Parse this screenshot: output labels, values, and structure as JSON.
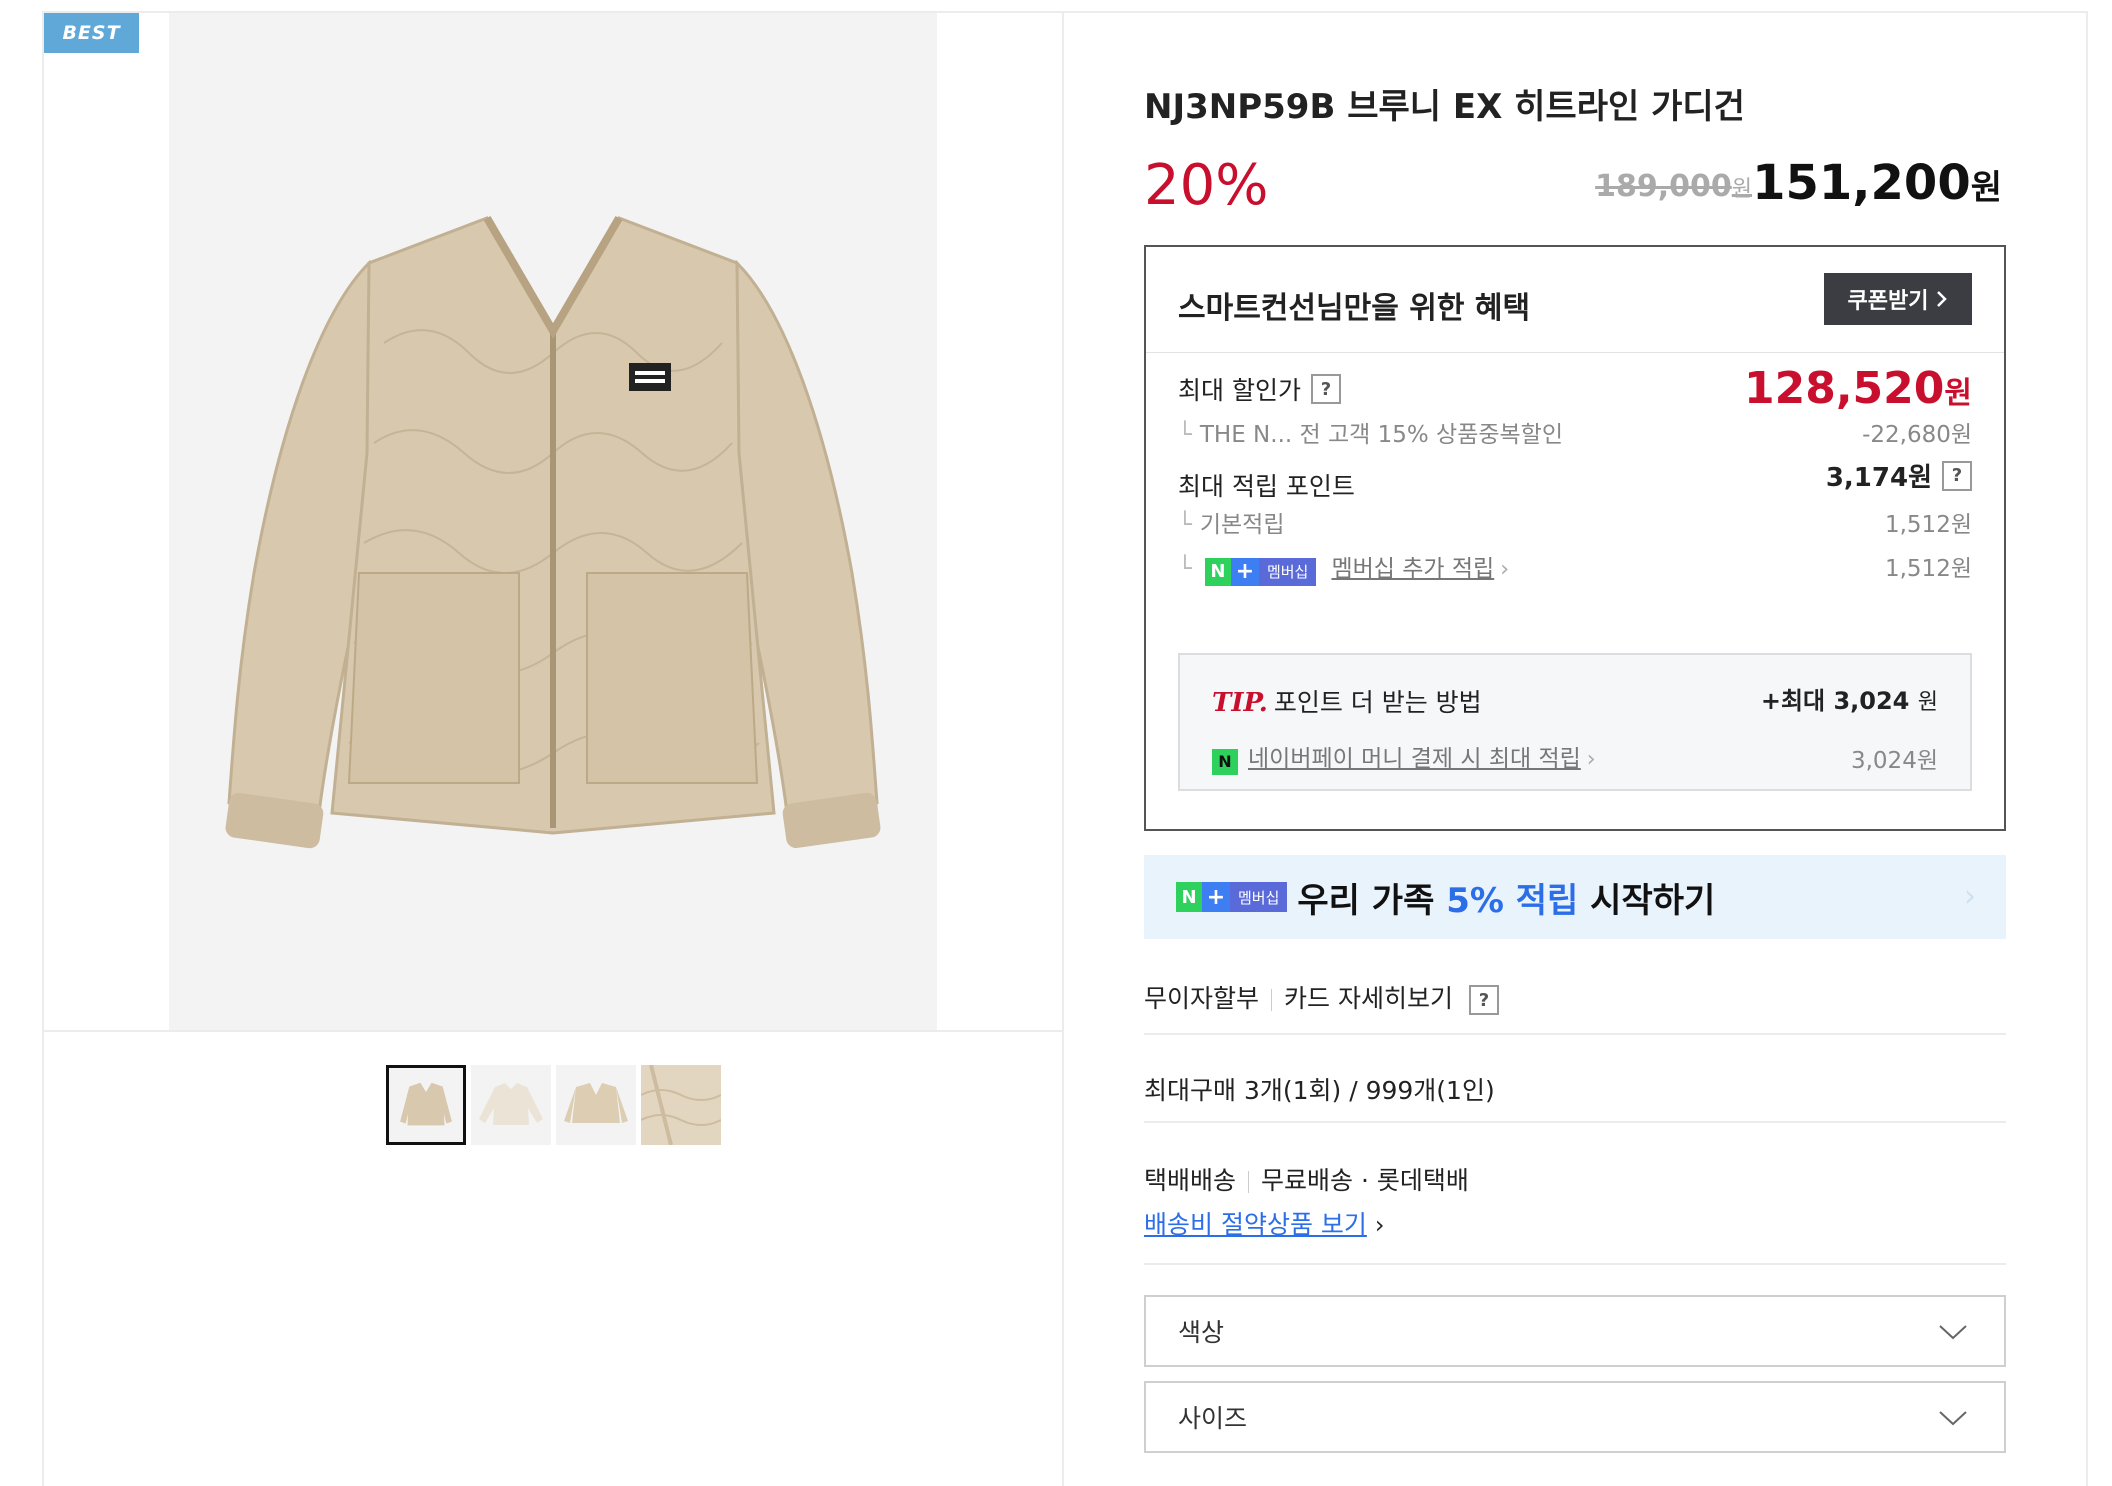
{
  "badge": "BEST",
  "gallery": {
    "main_image_alt": "",
    "thumbnails": [
      "",
      "",
      "",
      ""
    ]
  },
  "product": {
    "title": "NJ3NP59B 브루니 EX 히트라인 가디건",
    "discount_rate": "20%",
    "original_price": "189,000",
    "original_unit": "원",
    "sale_price": "151,200",
    "sale_unit": "원"
  },
  "benefit": {
    "title": "스마트컨선님만을 위한 혜택",
    "coupon_button": "쿠폰받기",
    "max_price_label": "최대 할인가",
    "max_price_value": "128,520",
    "max_price_unit": "원",
    "max_price_detail": "THE N... 전 고객 15% 상품중복할인",
    "max_price_discount": "-22,680원",
    "points_label": "최대 적립 포인트",
    "points_value": "3,174원",
    "basic_points_label": "기본적립",
    "basic_points_value": "1,512원",
    "membership_badge_n": "N",
    "membership_badge_plus": "+",
    "membership_badge_text": "멤버십",
    "membership_points_label": "멤버십 추가 적립",
    "membership_points_value": "1,512원",
    "tip": {
      "label": "TIP.",
      "title": "포인트 더 받는 방법",
      "max_value": "+최대 3,024",
      "max_unit": "원",
      "npay_icon": "N",
      "npay_link": "네이버페이 머니 결제 시 최대 적립",
      "npay_value": "3,024원"
    }
  },
  "member_banner": {
    "badge_text": "멤버십",
    "text_before": "우리 가족 ",
    "highlight": "5% 적립",
    "text_after": " 시작하기"
  },
  "payment": {
    "installment": "무이자할부",
    "card_detail": "카드 자세히보기"
  },
  "purchase_limit": "최대구매 3개(1회) / 999개(1인)",
  "shipping": {
    "type": "택배배송",
    "detail": "무료배송 · 롯데택배",
    "link": "배송비 절약상품 보기"
  },
  "options": {
    "color": "색상",
    "size": "사이즈"
  },
  "colors": {
    "sale_red": "#c8102e",
    "naver_green": "#2fd15d",
    "link_blue": "#2b6ee8",
    "badge_blue": "#5fa8d8"
  }
}
